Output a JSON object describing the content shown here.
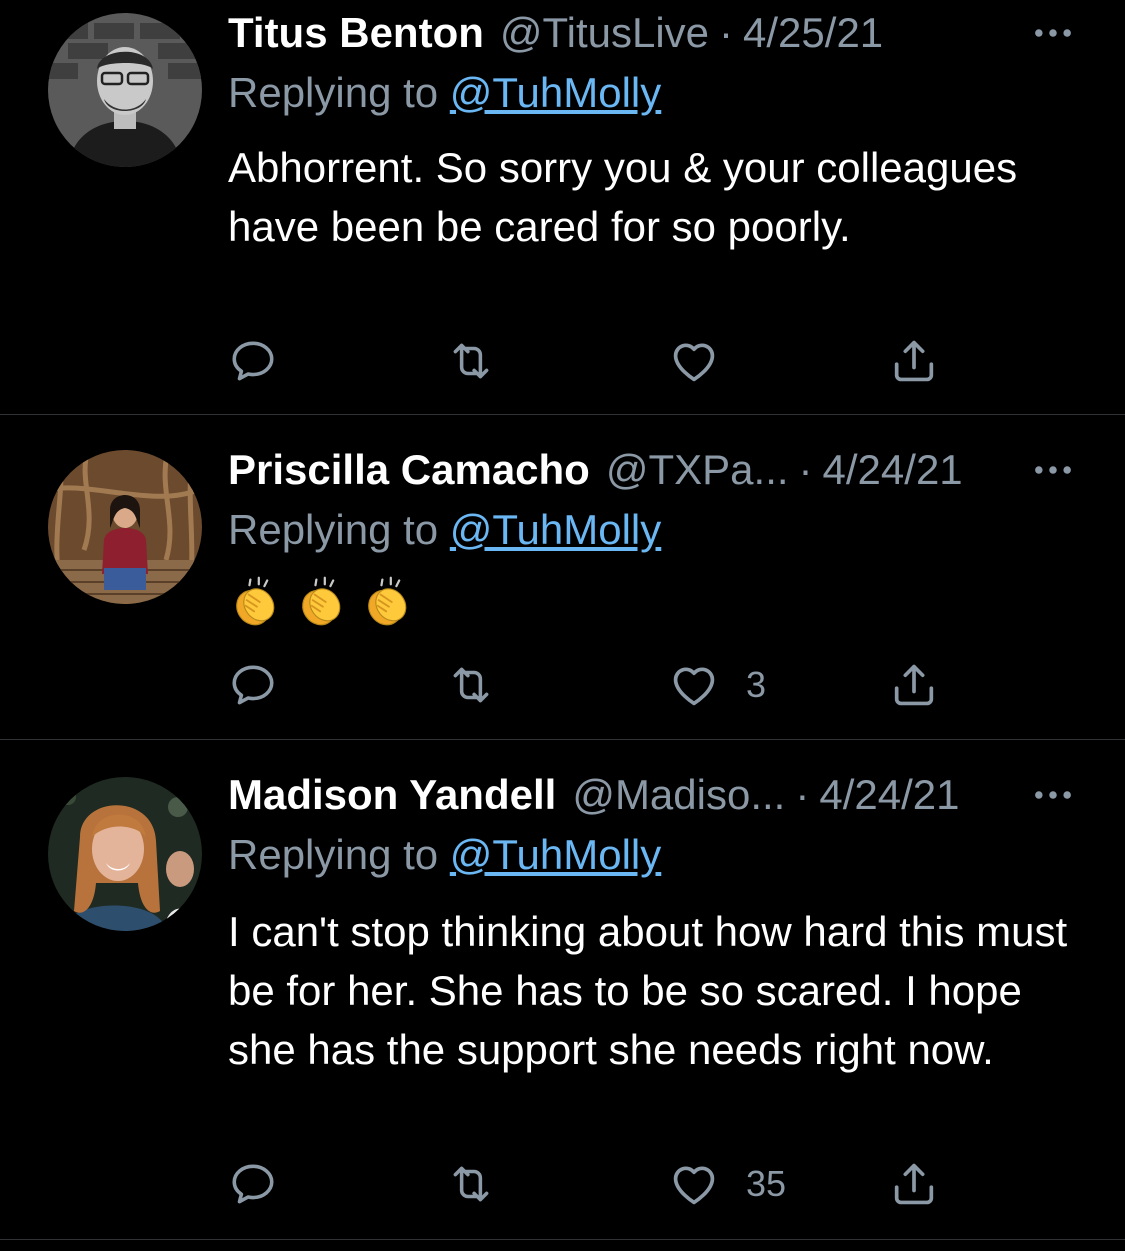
{
  "tweets": [
    {
      "name": "Titus Benton",
      "handle": "@TitusLive",
      "date": "4/25/21",
      "reply_prefix": "Replying to",
      "mention": "@TuhMolly",
      "text": "Abhorrent. So sorry you & your colleagues have been be cared for so poorly.",
      "like_count": ""
    },
    {
      "name": "Priscilla Camacho",
      "handle": "@TXPa...",
      "date": "4/24/21",
      "reply_prefix": "Replying to",
      "mention": "@TuhMolly",
      "emojis": [
        "clapping-hands",
        "clapping-hands",
        "clapping-hands"
      ],
      "like_count": "3"
    },
    {
      "name": "Madison Yandell",
      "handle": "@Madiso...",
      "date": "4/24/21",
      "reply_prefix": "Replying to",
      "mention": "@TuhMolly",
      "text": "I can't stop thinking about how hard this must be for her. She has to be so scared. I hope she has the support she needs right now.",
      "like_count": "35"
    }
  ],
  "icons": {
    "reply": "reply-icon",
    "retweet": "retweet-icon",
    "like": "heart-icon",
    "share": "share-icon",
    "more": "more-icon"
  },
  "colors": {
    "background": "#000000",
    "text": "#ffffff",
    "secondary": "#8b98a5",
    "link": "#6ab7f4",
    "divider": "#2f3336"
  }
}
